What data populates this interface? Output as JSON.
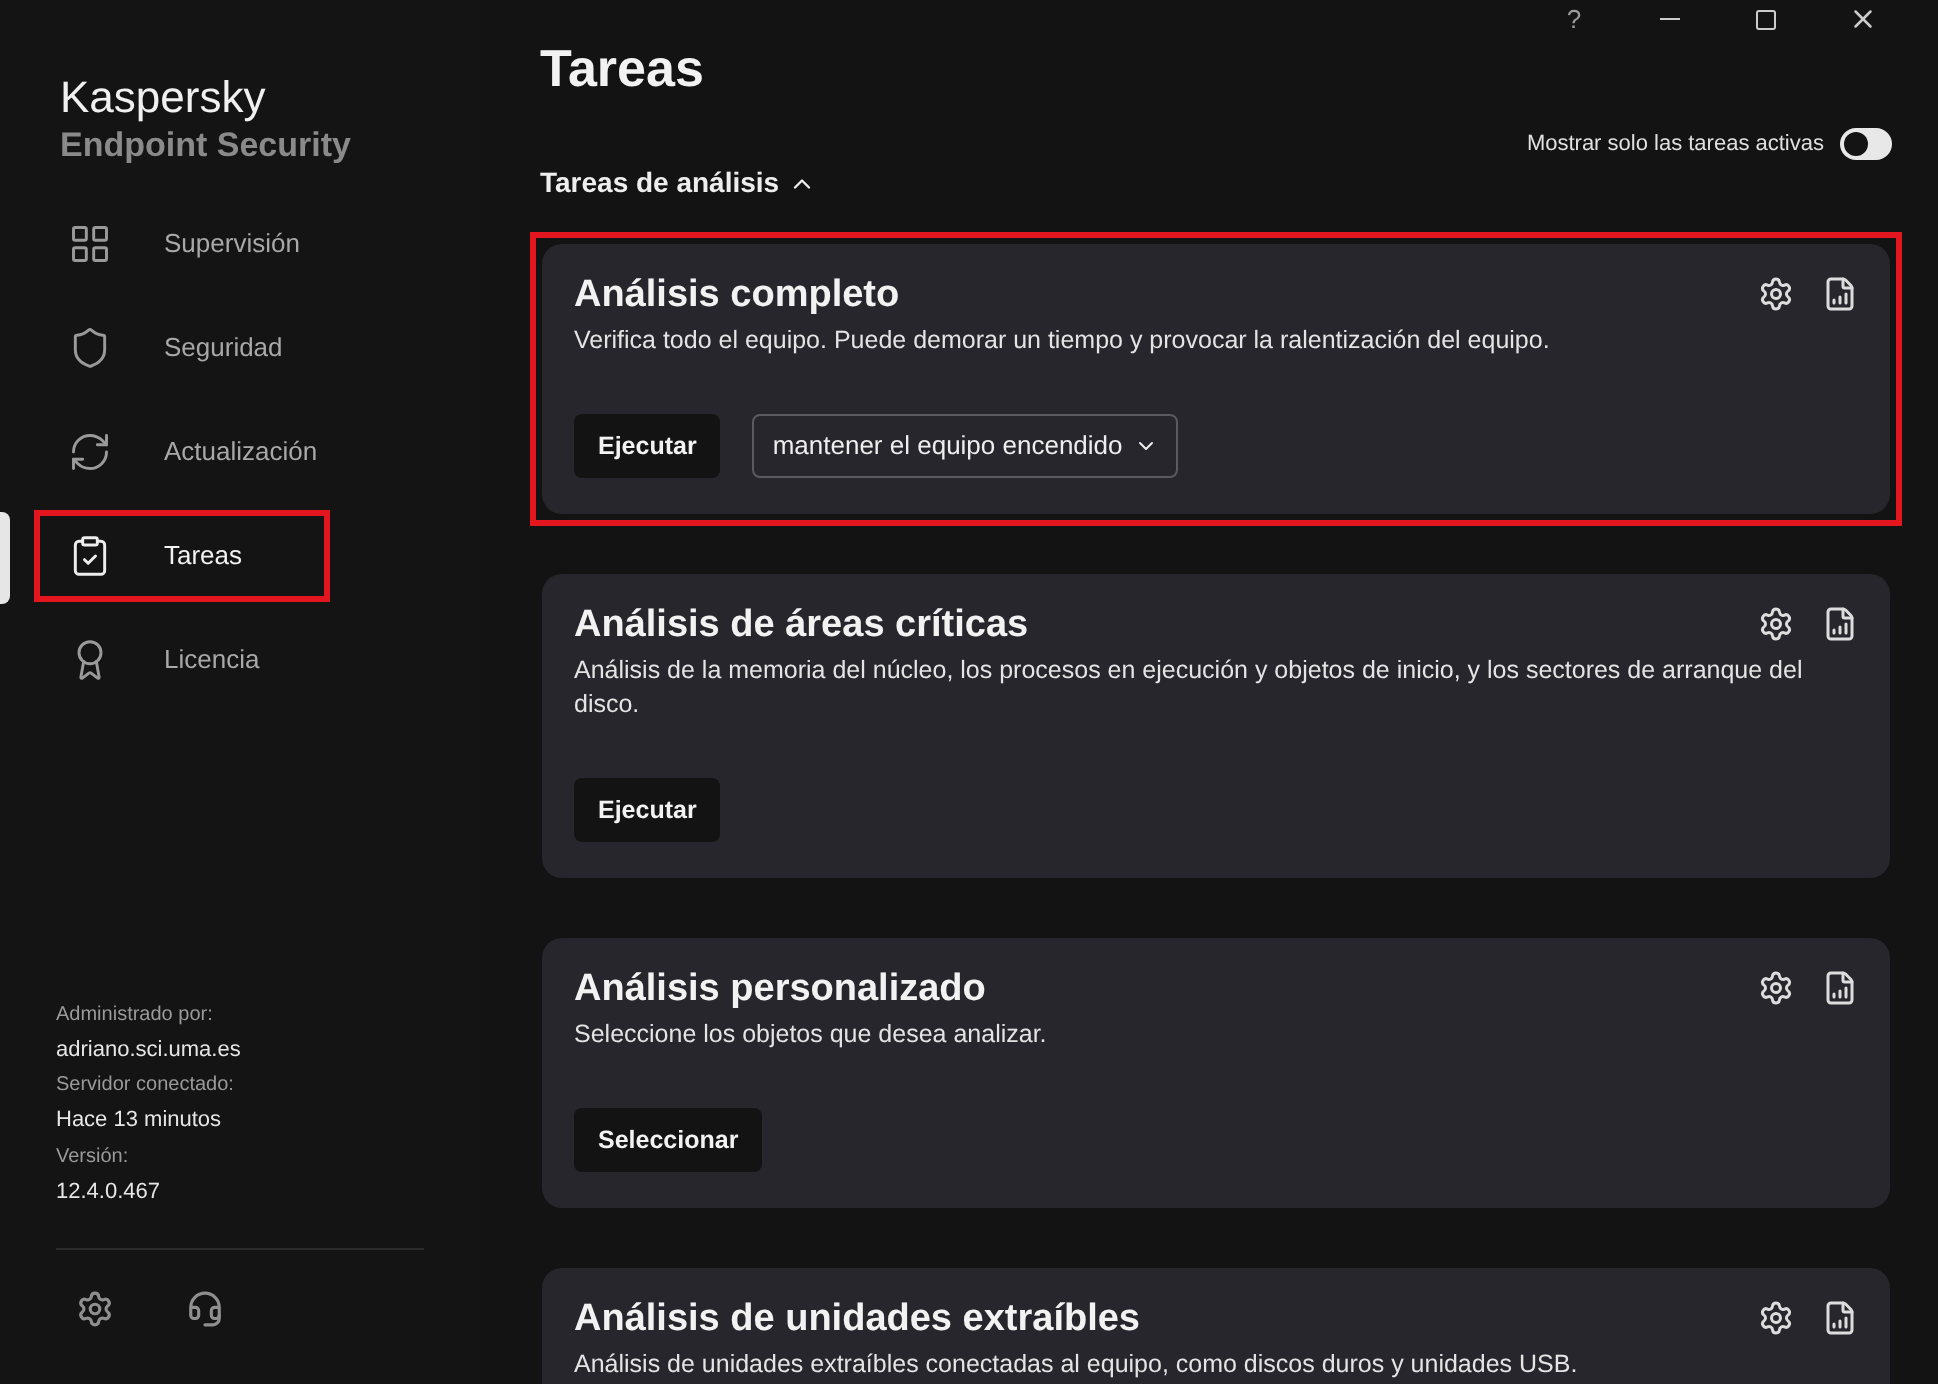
{
  "window": {
    "controls": [
      "?"
    ]
  },
  "brand": {
    "name": "Kaspersky",
    "product": "Endpoint Security"
  },
  "nav": [
    {
      "label": "Supervisión",
      "selected": false,
      "highlighted": false
    },
    {
      "label": "Seguridad",
      "selected": false,
      "highlighted": false
    },
    {
      "label": "Actualización",
      "selected": false,
      "highlighted": false
    },
    {
      "label": "Tareas",
      "selected": true,
      "highlighted": true
    },
    {
      "label": "Licencia",
      "selected": false,
      "highlighted": false
    }
  ],
  "info": [
    {
      "label": "Administrado por:",
      "value": "adriano.sci.uma.es"
    },
    {
      "label": "Servidor conectado:",
      "value": "Hace 13 minutos"
    },
    {
      "label": "Versión:",
      "value": "12.4.0.467"
    }
  ],
  "page_title": "Tareas",
  "active_only_toggle": {
    "label": "Mostrar solo las tareas activas",
    "on": false
  },
  "section": {
    "title": "Tareas de análisis",
    "expanded": true
  },
  "tasks": [
    {
      "title": "Análisis completo",
      "description": "Verifica todo el equipo. Puede demorar un tiempo y provocar la ralentización del equipo.",
      "button": "Ejecutar",
      "dropdown": "mantener el equipo encendido",
      "highlighted": true
    },
    {
      "title": "Análisis de áreas críticas",
      "description": "Análisis de la memoria del núcleo, los procesos en ejecución y objetos de inicio, y los sectores de arranque del disco.",
      "button": "Ejecutar",
      "highlighted": false
    },
    {
      "title": "Análisis personalizado",
      "description": "Seleccione los objetos que desea analizar.",
      "button": "Seleccionar",
      "highlighted": false
    },
    {
      "title": "Análisis de unidades extraíbles",
      "description": "Análisis de unidades extraíbles conectadas al equipo, como discos duros y unidades USB.",
      "highlighted": false
    }
  ]
}
